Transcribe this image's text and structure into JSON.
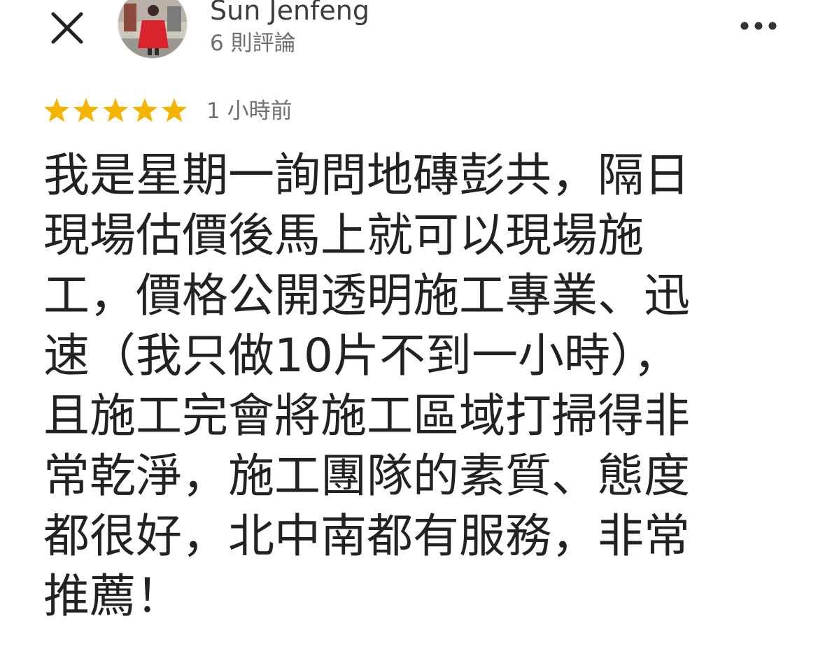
{
  "header": {
    "close_icon": "close-icon",
    "reviewer_name": "Sun Jenfeng",
    "review_count": "6 則評論",
    "more_icon": "more-horizontal-icon"
  },
  "review": {
    "rating": 5,
    "rating_max": 5,
    "star_color": "#F4B400",
    "time": "1 小時前",
    "text": "我是星期一詢問地磚彭共，隔日\n現場估價後馬上就可以現場施\n工，價格公開透明施工專業、迅\n速（我只做10片不到一小時），\n且施工完會將施工區域打掃得非\n常乾淨，施工團隊的素質、態度\n都很好，北中南都有服務，非常\n推薦！"
  }
}
